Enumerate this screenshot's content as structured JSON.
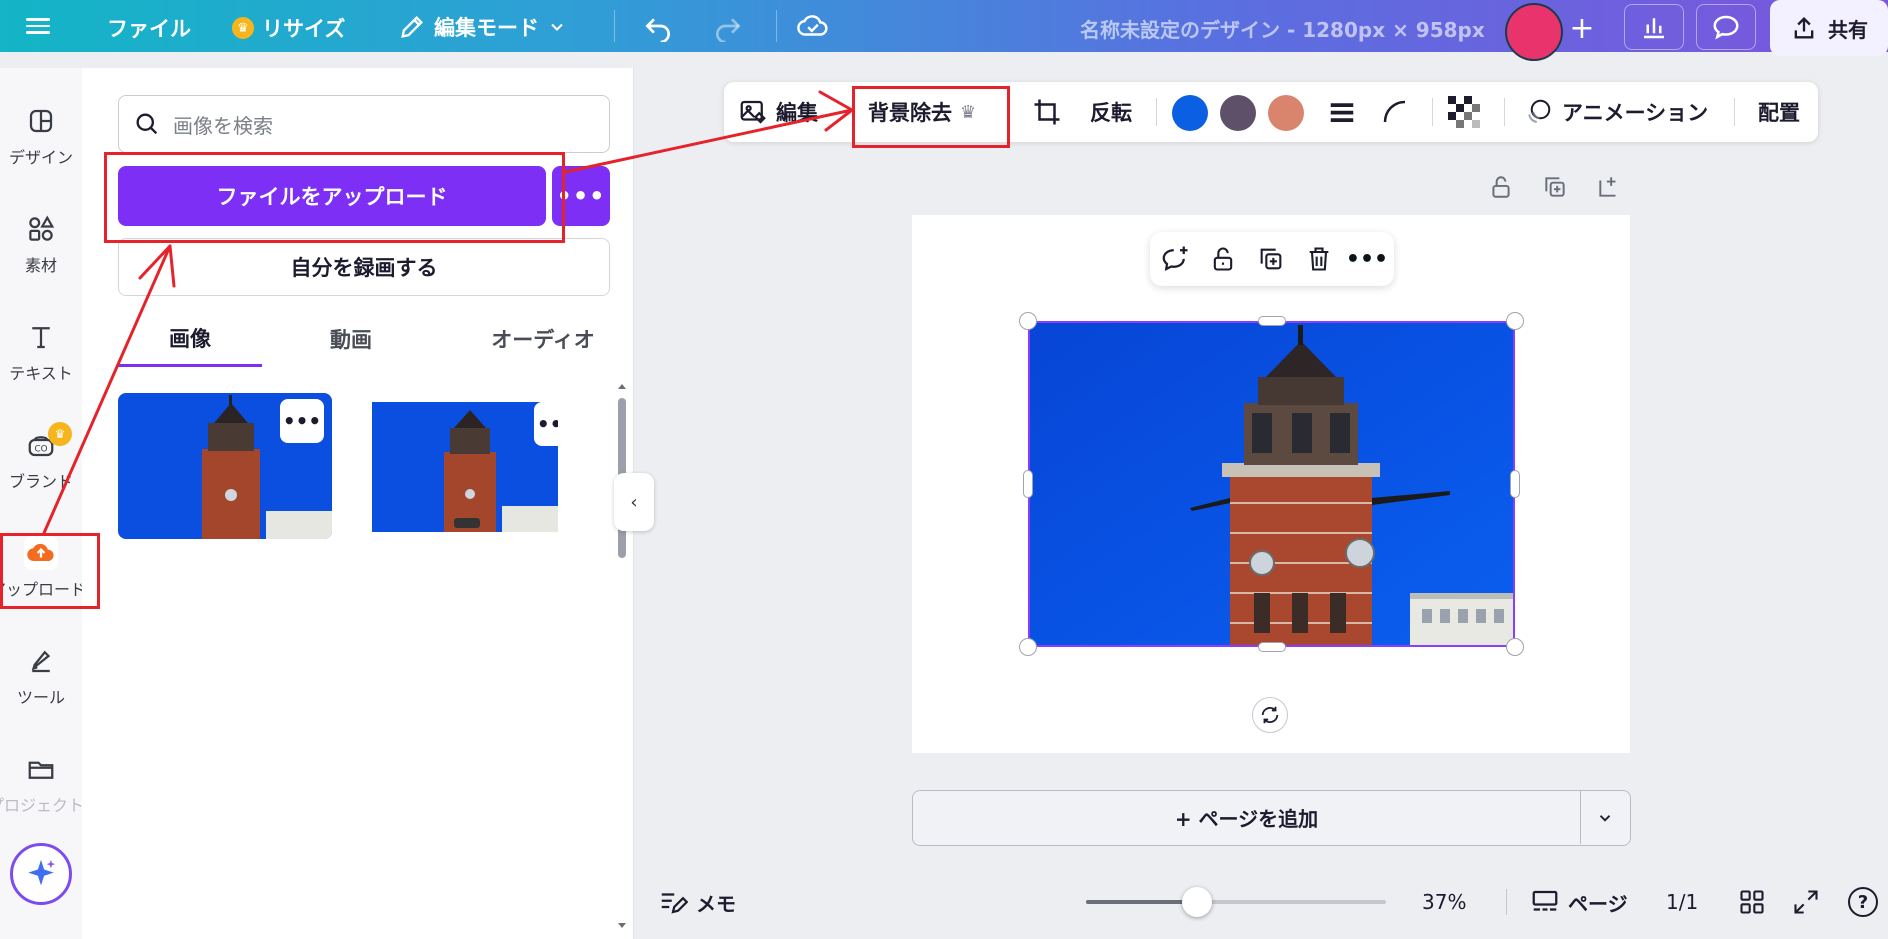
{
  "colors": {
    "accent": "#7d2ff5",
    "annotation": "#e5232b",
    "sky": "#0a4fe0"
  },
  "header": {
    "menu_icon": "hamburger-icon",
    "file": "ファイル",
    "resize": "リサイズ",
    "mode": "編集モード",
    "title": "名称未設定のデザイン - 1280px × 958px",
    "share": "共有"
  },
  "rail": {
    "items": [
      {
        "label": "デザイン",
        "icon": "layout-icon"
      },
      {
        "label": "素材",
        "icon": "shapes-icon"
      },
      {
        "label": "テキスト",
        "icon": "text-icon"
      },
      {
        "label": "ブランド",
        "icon": "brand-icon"
      },
      {
        "label": "アップロード",
        "icon": "upload-cloud-icon"
      },
      {
        "label": "ツール",
        "icon": "pen-tool-icon"
      },
      {
        "label": "プロジェクト",
        "icon": "folder-icon"
      }
    ]
  },
  "panel": {
    "search_placeholder": "画像を検索",
    "upload_button": "ファイルをアップロード",
    "more": "•••",
    "record_button": "自分を録画する",
    "tabs": [
      "画像",
      "動画",
      "オーディオ"
    ]
  },
  "toolbar": {
    "edit": "編集",
    "bg_remove": "背景除去",
    "flip": "反転",
    "swatches": [
      "#0a5fe3",
      "#5e5068",
      "#d9856e"
    ],
    "animation": "アニメーション",
    "position": "配置"
  },
  "canvas": {
    "add_page": "+ ページを追加"
  },
  "footer": {
    "notes": "メモ",
    "zoom_level": 37,
    "zoom": "37%",
    "pages": "ページ",
    "page_count": "1/1",
    "help": "?"
  }
}
